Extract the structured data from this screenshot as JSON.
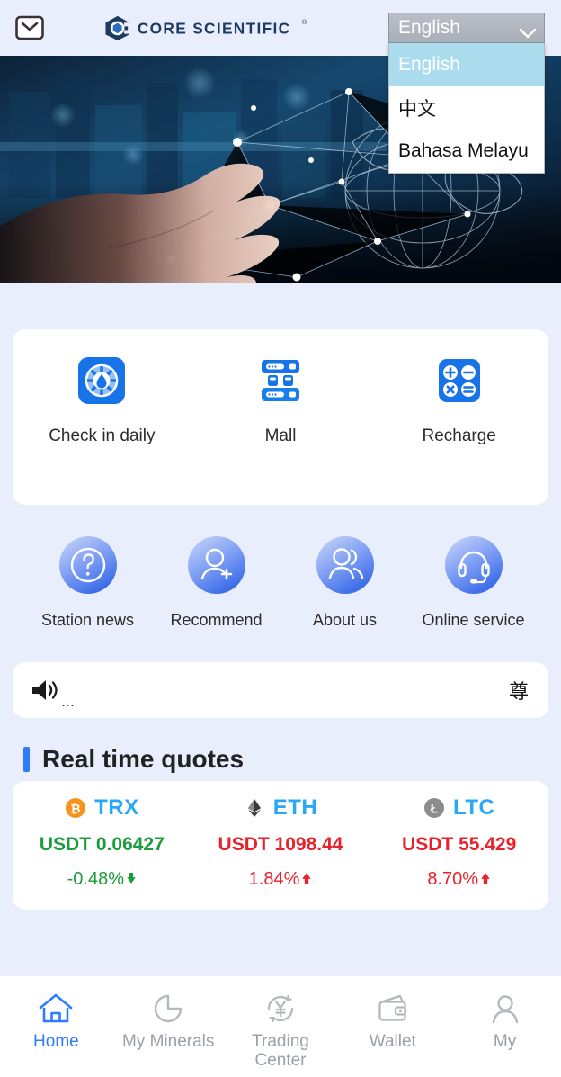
{
  "header": {
    "mail_icon": "envelope-icon",
    "brand": "CORE SCIENTIFIC",
    "brand_mark": "®"
  },
  "language_select": {
    "current": "English",
    "options": [
      {
        "label": "English",
        "selected": true
      },
      {
        "label": "中文",
        "selected": false
      },
      {
        "label": "Bahasa Melayu",
        "selected": false
      }
    ]
  },
  "banner": {
    "alt": "hand-touching-digital-globe-network"
  },
  "quick_actions": [
    {
      "label": "Check in daily",
      "icon": "check-in-icon"
    },
    {
      "label": "Mall",
      "icon": "server-rack-icon"
    },
    {
      "label": "Recharge",
      "icon": "calculator-icon"
    }
  ],
  "shortcuts": [
    {
      "label": "Station news",
      "icon": "question-circle-icon"
    },
    {
      "label": "Recommend",
      "icon": "user-add-icon"
    },
    {
      "label": "About us",
      "icon": "users-icon"
    },
    {
      "label": "Online service",
      "icon": "headset-icon"
    }
  ],
  "notice": {
    "icon": "speaker-icon",
    "dots": "...",
    "text": "尊"
  },
  "quotes_section": {
    "title": "Real time quotes"
  },
  "quotes": [
    {
      "symbol": "TRX",
      "icon": "bitcoin-coin-icon",
      "price": "USDT 0.06427",
      "price_dir": "down",
      "change": "-0.48%",
      "change_dir": "down",
      "arrow": "↓"
    },
    {
      "symbol": "ETH",
      "icon": "ethereum-coin-icon",
      "price": "USDT 1098.44",
      "price_dir": "up",
      "change": "1.84%",
      "change_dir": "up",
      "arrow": "↑"
    },
    {
      "symbol": "LTC",
      "icon": "litecoin-coin-icon",
      "price": "USDT 55.429",
      "price_dir": "up",
      "change": "8.70%",
      "change_dir": "up",
      "arrow": "↑"
    }
  ],
  "tabbar": [
    {
      "label": "Home",
      "icon": "home-icon",
      "active": true
    },
    {
      "label": "My Minerals",
      "icon": "pie-chart-icon",
      "active": false
    },
    {
      "label": "Trading\nCenter",
      "icon": "currency-exchange-icon",
      "active": false
    },
    {
      "label": "Wallet",
      "icon": "wallet-icon",
      "active": false
    },
    {
      "label": "My",
      "icon": "person-icon",
      "active": false
    }
  ],
  "colors": {
    "page_bg": "#e9eefc",
    "accent": "#2f7bfd",
    "coin_symbol": "#2aa8f8",
    "up": "#e8212b",
    "down": "#1c9c3c",
    "select_highlight": "#aadcee"
  }
}
